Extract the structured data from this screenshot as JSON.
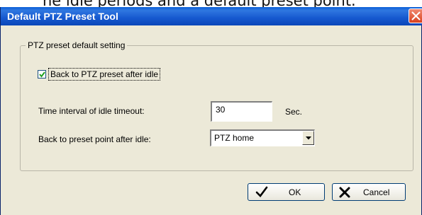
{
  "document": {
    "text_above": "he idle periods and a default preset point."
  },
  "window": {
    "title": "Default PTZ Preset Tool"
  },
  "group": {
    "legend": "PTZ preset default setting",
    "checkbox_label": "Back to PTZ preset after idle",
    "checkbox_checked": true,
    "idle_timeout_label": "Time interval of idle timeout:",
    "idle_timeout_value": "30",
    "idle_timeout_unit": "Sec.",
    "preset_label": "Back to preset point after idle:",
    "preset_selected": "PTZ home"
  },
  "buttons": {
    "ok": "OK",
    "cancel": "Cancel"
  },
  "colors": {
    "titlebar": "#1658cf",
    "dialog_bg": "#ece9d8",
    "close": "#d9411e"
  }
}
